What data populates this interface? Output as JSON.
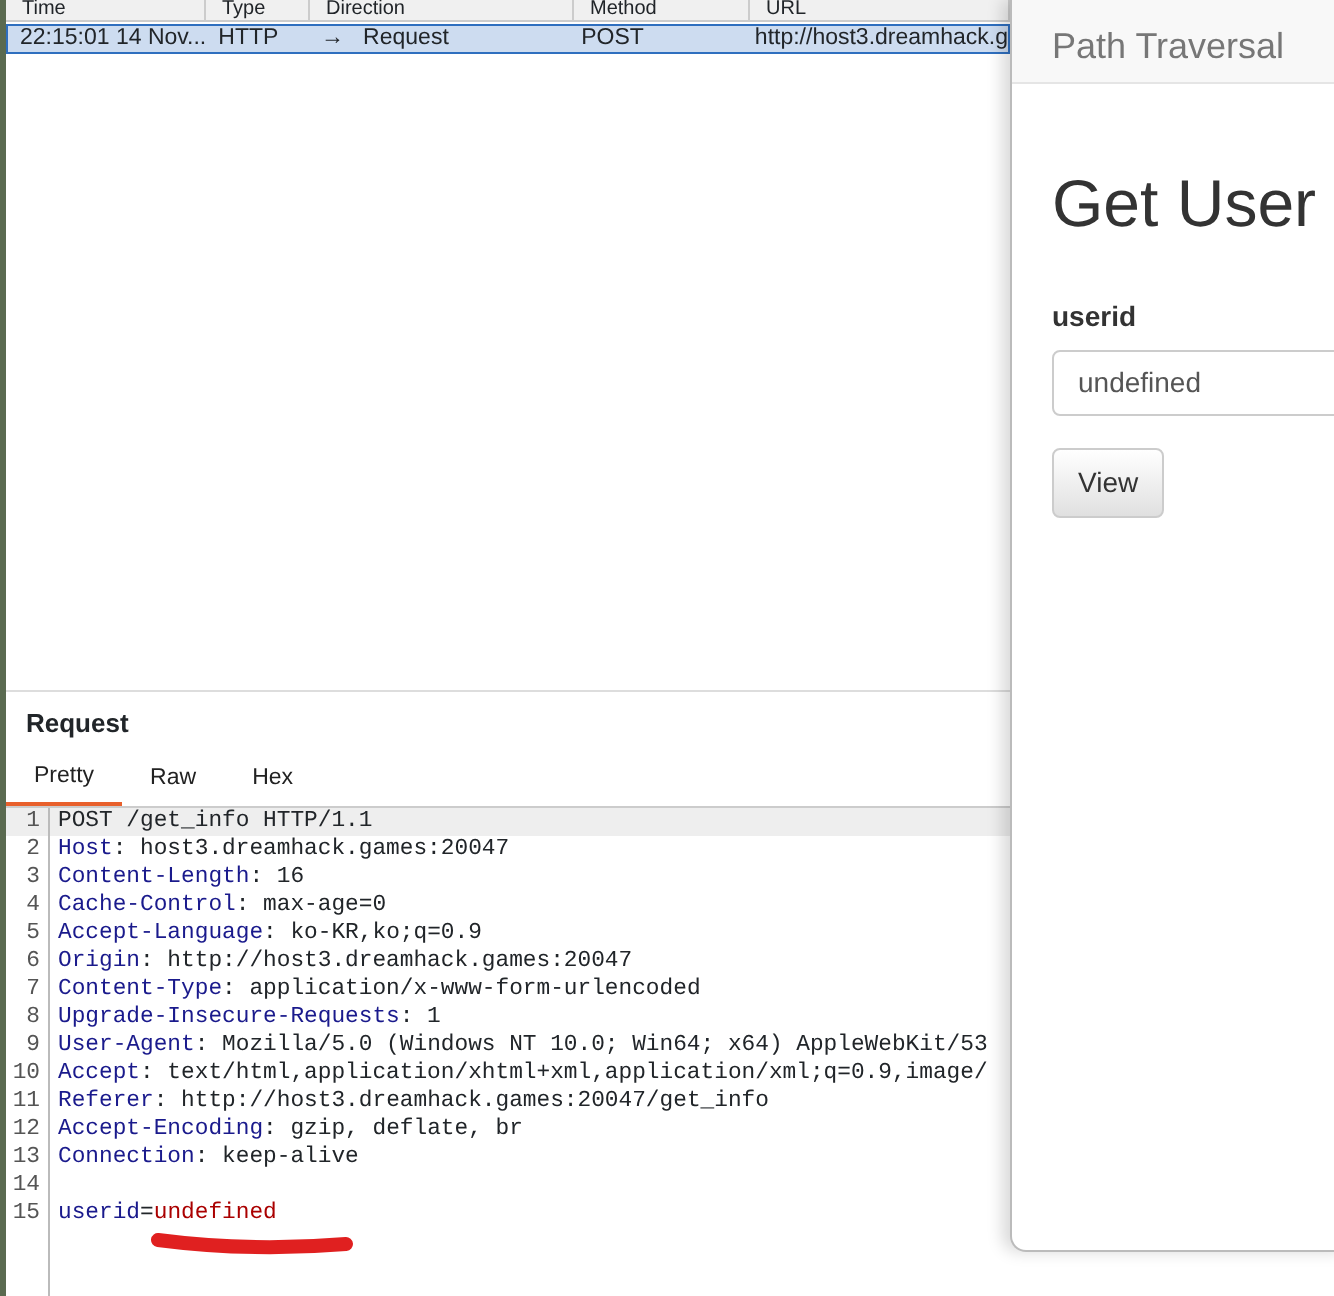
{
  "history": {
    "columns": [
      "Time",
      "Type",
      "Direction",
      "Method",
      "URL"
    ],
    "rows": [
      {
        "selected": true,
        "cells": [
          "22:15:01 14 Nov...",
          "HTTP",
          "→   Request",
          "POST",
          "http://host3.dreamhack.g"
        ]
      }
    ]
  },
  "request": {
    "title": "Request",
    "tabs": [
      {
        "label": "Pretty",
        "selected": true
      },
      {
        "label": "Raw",
        "selected": false
      },
      {
        "label": "Hex",
        "selected": false
      }
    ],
    "lines": [
      {
        "number": "1",
        "segments": [
          {
            "kind": "plain",
            "text": "POST /get_info HTTP/1.1"
          }
        ]
      },
      {
        "number": "2",
        "segments": [
          {
            "kind": "name",
            "text": "Host"
          },
          {
            "kind": "plain",
            "text": ": host3.dreamhack.games:20047"
          }
        ]
      },
      {
        "number": "3",
        "segments": [
          {
            "kind": "name",
            "text": "Content-Length"
          },
          {
            "kind": "plain",
            "text": ": 16"
          }
        ]
      },
      {
        "number": "4",
        "segments": [
          {
            "kind": "name",
            "text": "Cache-Control"
          },
          {
            "kind": "plain",
            "text": ": max-age=0"
          }
        ]
      },
      {
        "number": "5",
        "segments": [
          {
            "kind": "name",
            "text": "Accept-Language"
          },
          {
            "kind": "plain",
            "text": ": ko-KR,ko;q=0.9"
          }
        ]
      },
      {
        "number": "6",
        "segments": [
          {
            "kind": "name",
            "text": "Origin"
          },
          {
            "kind": "plain",
            "text": ": http://host3.dreamhack.games:20047"
          }
        ]
      },
      {
        "number": "7",
        "segments": [
          {
            "kind": "name",
            "text": "Content-Type"
          },
          {
            "kind": "plain",
            "text": ": application/x-www-form-urlencoded"
          }
        ]
      },
      {
        "number": "8",
        "segments": [
          {
            "kind": "name",
            "text": "Upgrade-Insecure-Requests"
          },
          {
            "kind": "plain",
            "text": ": 1"
          }
        ]
      },
      {
        "number": "9",
        "segments": [
          {
            "kind": "name",
            "text": "User-Agent"
          },
          {
            "kind": "plain",
            "text": ": Mozilla/5.0 (Windows NT 10.0; Win64; x64) AppleWebKit/53"
          }
        ]
      },
      {
        "number": "10",
        "segments": [
          {
            "kind": "name",
            "text": "Accept"
          },
          {
            "kind": "plain",
            "text": ": text/html,application/xhtml+xml,application/xml;q=0.9,image/"
          }
        ]
      },
      {
        "number": "11",
        "segments": [
          {
            "kind": "name",
            "text": "Referer"
          },
          {
            "kind": "plain",
            "text": ": http://host3.dreamhack.games:20047/get_info"
          }
        ]
      },
      {
        "number": "12",
        "segments": [
          {
            "kind": "name",
            "text": "Accept-Encoding"
          },
          {
            "kind": "plain",
            "text": ": gzip, deflate, br"
          }
        ]
      },
      {
        "number": "13",
        "segments": [
          {
            "kind": "name",
            "text": "Connection"
          },
          {
            "kind": "plain",
            "text": ": keep-alive"
          }
        ]
      },
      {
        "number": "14"
      },
      {
        "number": "15",
        "segments": [
          {
            "kind": "name",
            "text": "userid"
          },
          {
            "kind": "plain",
            "text": "="
          },
          {
            "kind": "value",
            "text": "undefined"
          }
        ]
      }
    ]
  },
  "browser": {
    "brand": "Path Traversal",
    "heading": "Get User",
    "field_label": "userid",
    "field_value": "undefined",
    "button": "View"
  }
}
